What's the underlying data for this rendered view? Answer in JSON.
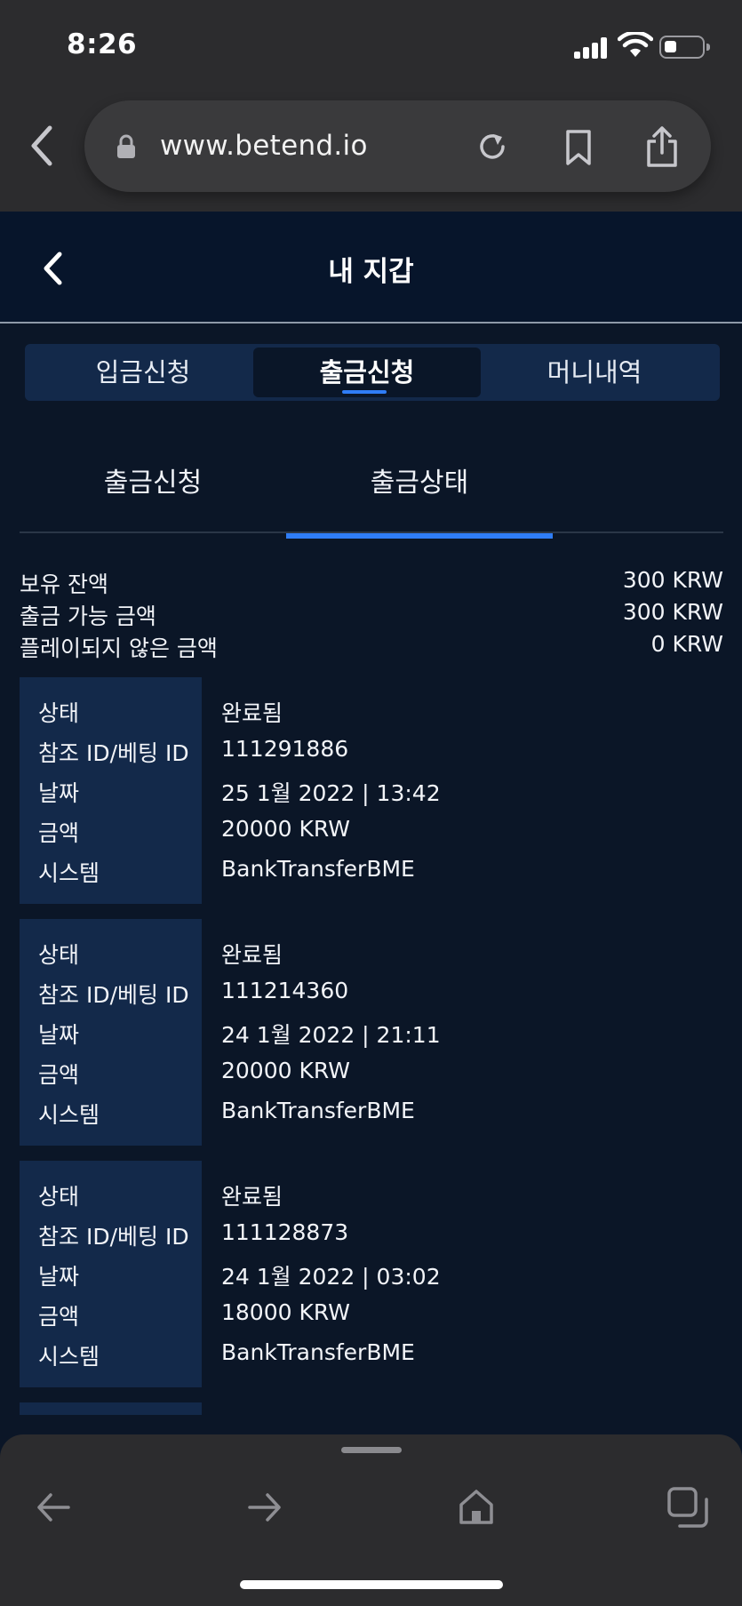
{
  "status_bar": {
    "time": "8:26"
  },
  "browser": {
    "url": "www.betend.io"
  },
  "header": {
    "title": "내 지갑"
  },
  "main_tabs": [
    {
      "label": "입금신청"
    },
    {
      "label": "출금신청"
    },
    {
      "label": "머니내역"
    }
  ],
  "sub_tabs": [
    {
      "label": "출금신청"
    },
    {
      "label": "출금상태"
    }
  ],
  "balance": [
    {
      "label": "보유 잔액",
      "value": "300 KRW"
    },
    {
      "label": "출금 가능 금액",
      "value": "300 KRW"
    },
    {
      "label": "플레이되지 않은 금액",
      "value": "0 KRW"
    }
  ],
  "field_labels": {
    "status": "상태",
    "ref_id": "참조 ID/베팅 ID",
    "date": "날짜",
    "amount": "금액",
    "system": "시스템"
  },
  "withdrawals": [
    {
      "status": "완료됨",
      "ref_id": "111291886",
      "date": "25 1월 2022 | 13:42",
      "amount": "20000 KRW",
      "system": "BankTransferBME"
    },
    {
      "status": "완료됨",
      "ref_id": "111214360",
      "date": "24 1월 2022 | 21:11",
      "amount": "20000 KRW",
      "system": "BankTransferBME"
    },
    {
      "status": "완료됨",
      "ref_id": "111128873",
      "date": "24 1월 2022 | 03:02",
      "amount": "18000 KRW",
      "system": "BankTransferBME"
    }
  ],
  "colors": {
    "background": "#0b1627",
    "panel": "#13294a",
    "accent": "#2f7df6",
    "chrome": "#2c2c2e"
  }
}
